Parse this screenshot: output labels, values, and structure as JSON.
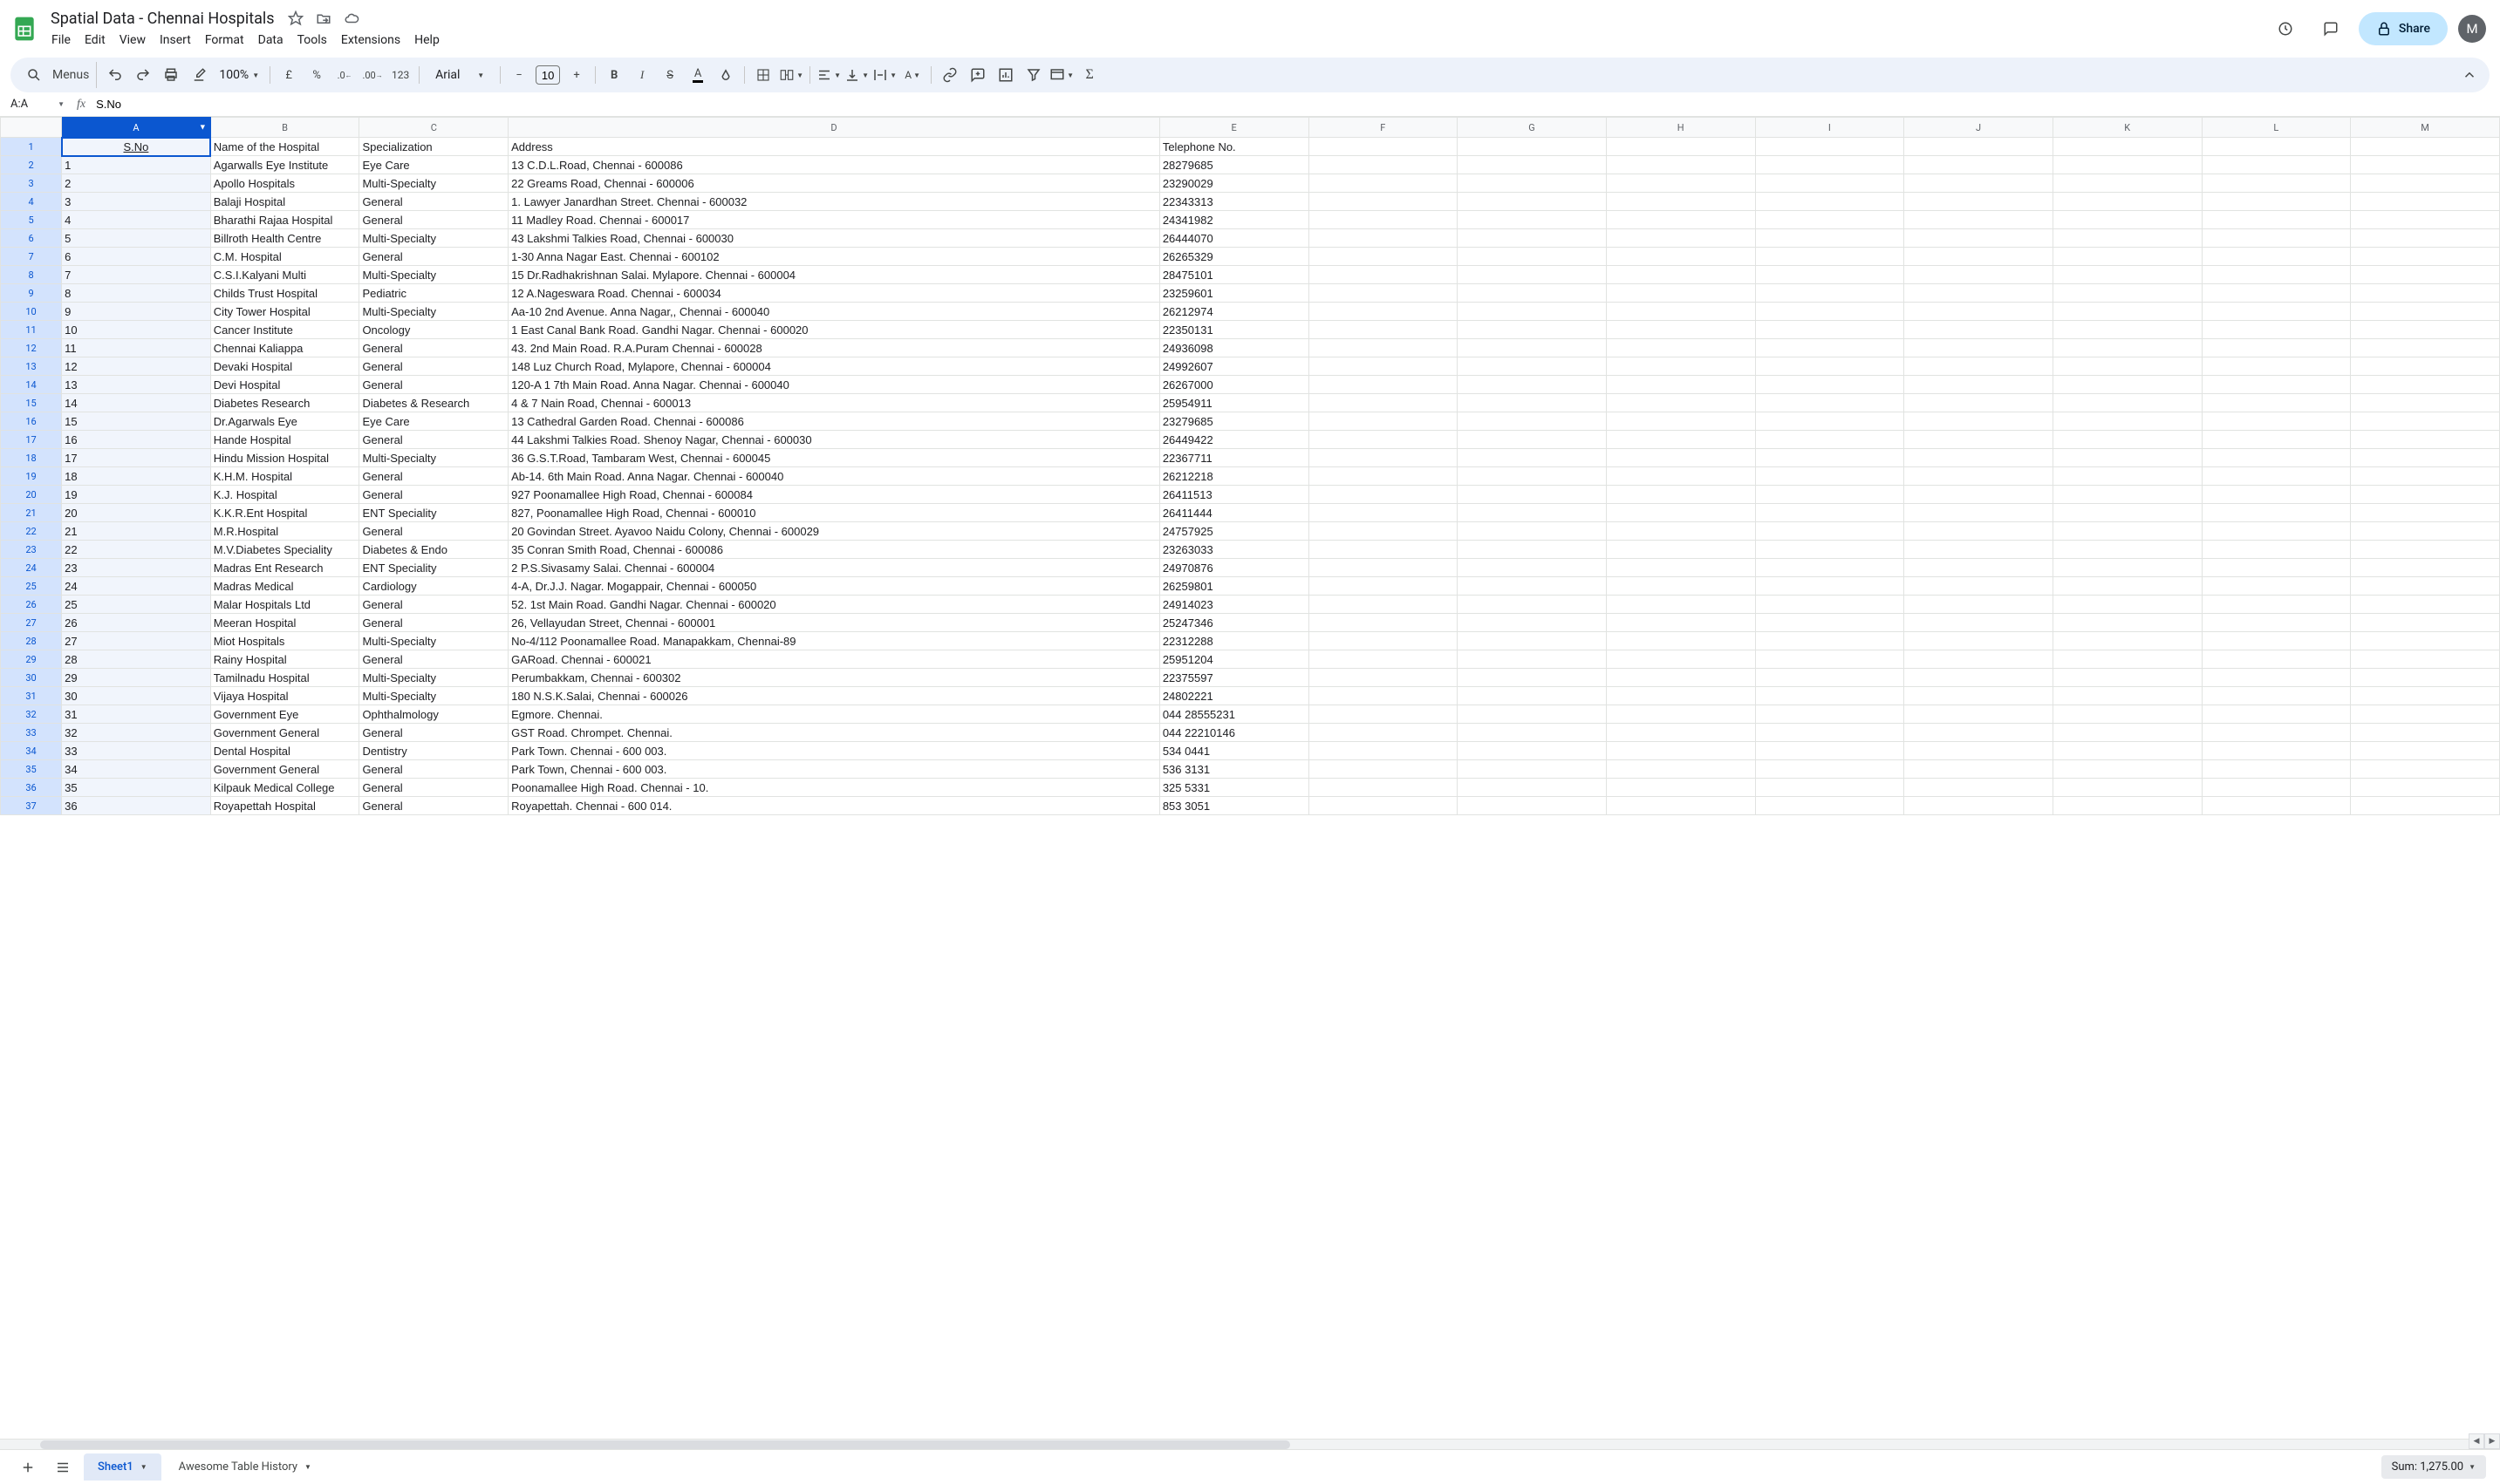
{
  "doc": {
    "title": "Spatial Data - Chennai Hospitals"
  },
  "menu": [
    "File",
    "Edit",
    "View",
    "Insert",
    "Format",
    "Data",
    "Tools",
    "Extensions",
    "Help"
  ],
  "header": {
    "share": "Share",
    "avatar": "M"
  },
  "toolbar": {
    "search_placeholder": "Menus",
    "zoom": "100%",
    "currency": "£",
    "percent": "%",
    "dec_dec": ".0",
    "inc_dec": ".00",
    "num_fmt": "123",
    "font": "Arial",
    "font_size": "10"
  },
  "namebox": "A:A",
  "formula": "S.No",
  "columns": [
    "A",
    "B",
    "C",
    "D",
    "E",
    "F",
    "G",
    "H",
    "I",
    "J",
    "K",
    "L",
    "M"
  ],
  "headers_row": [
    "S.No",
    "Name of the Hospital",
    "Specialization",
    "Address",
    "Telephone No."
  ],
  "rows": [
    [
      "1",
      "Agarwalls Eye Institute",
      "Eye Care",
      "13 C.D.L.Road, Chennai - 600086",
      "28279685"
    ],
    [
      "2",
      "Apollo Hospitals",
      "Multi-Specialty",
      "22 Greams Road, Chennai - 600006",
      "23290029"
    ],
    [
      "3",
      "Balaji Hospital",
      "General",
      "1. Lawyer Janardhan Street. Chennai - 600032",
      "22343313"
    ],
    [
      "4",
      "Bharathi Rajaa Hospital",
      "General",
      "11 Madley Road. Chennai - 600017",
      "24341982"
    ],
    [
      "5",
      "Billroth Health Centre",
      "Multi-Specialty",
      "43 Lakshmi Talkies Road, Chennai - 600030",
      "26444070"
    ],
    [
      "6",
      "C.M. Hospital",
      "General",
      "1-30 Anna Nagar East. Chennai - 600102",
      "26265329"
    ],
    [
      "7",
      "C.S.I.Kalyani Multi",
      "Multi-Specialty",
      "15 Dr.Radhakrishnan Salai. Mylapore. Chennai - 600004",
      "28475101"
    ],
    [
      "8",
      "Childs Trust Hospital",
      "Pediatric",
      "12 A.Nageswara Road. Chennai - 600034",
      "23259601"
    ],
    [
      "9",
      "City Tower Hospital",
      "Multi-Specialty",
      "Aa-10 2nd Avenue. Anna Nagar,, Chennai - 600040",
      "26212974"
    ],
    [
      "10",
      "Cancer Institute",
      "Oncology",
      "1 East Canal Bank Road. Gandhi Nagar. Chennai - 600020",
      "22350131"
    ],
    [
      "11",
      "Chennai Kaliappa",
      "General",
      "43. 2nd Main Road. R.A.Puram Chennai - 600028",
      "24936098"
    ],
    [
      "12",
      "Devaki Hospital",
      "General",
      "148 Luz Church Road, Mylapore, Chennai - 600004",
      "24992607"
    ],
    [
      "13",
      "Devi Hospital",
      "General",
      "120-A 1 7th Main Road. Anna Nagar. Chennai - 600040",
      "26267000"
    ],
    [
      "14",
      "Diabetes Research",
      "Diabetes & Research",
      "4 & 7 Nain Road, Chennai - 600013",
      "25954911"
    ],
    [
      "15",
      "Dr.Agarwals Eye",
      "Eye Care",
      "13 Cathedral Garden Road. Chennai - 600086",
      "23279685"
    ],
    [
      "16",
      "Hande Hospital",
      "General",
      "44 Lakshmi Talkies Road. Shenoy Nagar, Chennai - 600030",
      "26449422"
    ],
    [
      "17",
      "Hindu Mission Hospital",
      "Multi-Specialty",
      "36 G.S.T.Road, Tambaram West, Chennai - 600045",
      "22367711"
    ],
    [
      "18",
      "K.H.M. Hospital",
      "General",
      "Ab-14. 6th Main Road. Anna Nagar. Chennai - 600040",
      "26212218"
    ],
    [
      "19",
      "K.J. Hospital",
      "General",
      "927 Poonamallee High Road, Chennai - 600084",
      "26411513"
    ],
    [
      "20",
      "K.K.R.Ent Hospital",
      "ENT Speciality",
      "827, Poonamallee High Road, Chennai - 600010",
      "26411444"
    ],
    [
      "21",
      "M.R.Hospital",
      "General",
      "20 Govindan Street. Ayavoo Naidu Colony, Chennai - 600029",
      "24757925"
    ],
    [
      "22",
      "M.V.Diabetes Speciality",
      "Diabetes & Endo",
      "35 Conran Smith Road, Chennai - 600086",
      "23263033"
    ],
    [
      "23",
      "Madras Ent Research",
      "ENT Speciality",
      "2 P.S.Sivasamy Salai. Chennai - 600004",
      "24970876"
    ],
    [
      "24",
      "Madras Medical",
      "Cardiology",
      "4-A, Dr.J.J. Nagar. Mogappair, Chennai - 600050",
      "26259801"
    ],
    [
      "25",
      "Malar Hospitals Ltd",
      "General",
      "52. 1st Main Road. Gandhi Nagar. Chennai - 600020",
      "24914023"
    ],
    [
      "26",
      "Meeran Hospital",
      "General",
      "26, Vellayudan Street, Chennai - 600001",
      "25247346"
    ],
    [
      "27",
      "Miot Hospitals",
      "Multi-Specialty",
      "No-4/112 Poonamallee Road. Manapakkam, Chennai-89",
      "22312288"
    ],
    [
      "28",
      "Rainy Hospital",
      "General",
      "GARoad. Chennai - 600021",
      "25951204"
    ],
    [
      "29",
      "Tamilnadu Hospital",
      "Multi-Specialty",
      "Perumbakkam, Chennai - 600302",
      "22375597"
    ],
    [
      "30",
      "Vijaya Hospital",
      "Multi-Specialty",
      "180 N.S.K.Salai, Chennai - 600026",
      "24802221"
    ],
    [
      "31",
      "Government Eye",
      "Ophthalmology",
      "Egmore. Chennai.",
      "044 28555231"
    ],
    [
      "32",
      "Government General",
      "General",
      "GST Road. Chrompet. Chennai.",
      "044 22210146"
    ],
    [
      "33",
      "Dental Hospital",
      "Dentistry",
      "Park Town. Chennai - 600 003.",
      "534 0441"
    ],
    [
      "34",
      "Government General",
      "General",
      "Park Town, Chennai - 600 003.",
      "536 3131"
    ],
    [
      "35",
      "Kilpauk Medical College",
      "General",
      "Poonamallee High Road. Chennai - 10.",
      "325 5331"
    ],
    [
      "36",
      "Royapettah Hospital",
      "General",
      "Royapettah. Chennai - 600 014.",
      "853 3051"
    ]
  ],
  "bottom": {
    "sheet_tab": "Sheet1",
    "history": "Awesome Table History",
    "sum": "Sum: 1,275.00"
  }
}
